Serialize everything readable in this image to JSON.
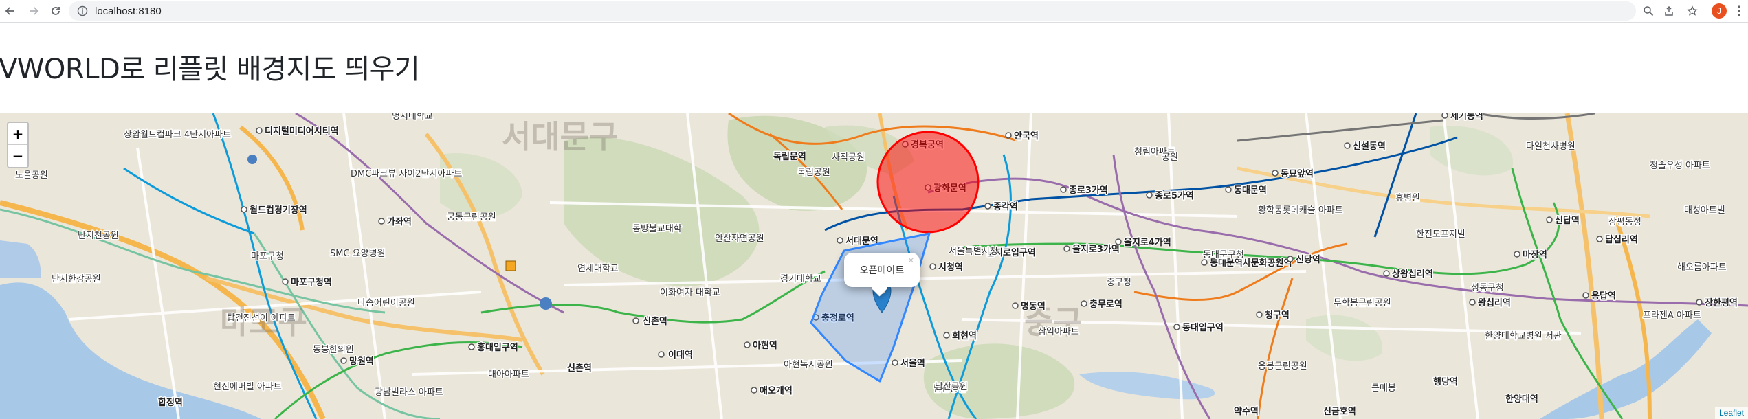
{
  "browser": {
    "url": "localhost:8180",
    "profile_initial": "J",
    "icons": [
      "back-arrow-icon",
      "forward-arrow-icon",
      "reload-icon",
      "site-info-icon",
      "zoom-icon",
      "share-icon",
      "bookmark-star-icon",
      "profile-avatar",
      "more-menu-icon"
    ]
  },
  "page": {
    "title": "VWORLD로 리플릿 배경지도 띄우기"
  },
  "map": {
    "zoom_in_label": "+",
    "zoom_out_label": "−",
    "popup_text": "오픈메이트",
    "popup_close": "×",
    "attribution": "Leaflet",
    "circle_color": "#ff0000",
    "polygon_color": "#3388ff",
    "marker_color": "#2a81cb",
    "districts": [
      "서대문구",
      "마포구",
      "중구"
    ],
    "stations": [
      "신촌역",
      "이대역",
      "아현역",
      "충정로역",
      "서울역",
      "시청역",
      "광화문역",
      "경복궁역",
      "안국역",
      "종각역",
      "종로3가역",
      "종로5가역",
      "동대문역",
      "동묘앞역",
      "을지로입구역",
      "을지로3가역",
      "을지로4가역",
      "동대문역사문화공원역",
      "신당역",
      "충무로역",
      "회현역",
      "명동역",
      "동대입구역",
      "약수역",
      "청구역",
      "신금호역",
      "행당역",
      "상왕십리역",
      "왕십리역",
      "한양대역",
      "마장역",
      "답십리역",
      "용답역",
      "장한평역",
      "신설동역",
      "제기동역",
      "독립문역",
      "홍대입구역",
      "합정역",
      "망원역",
      "마포구청역",
      "월드컵경기장역",
      "디지털미디어시티역",
      "가좌역",
      "신촌역",
      "애오개역",
      "서대문역",
      "신답역"
    ],
    "places": [
      "명지대학교",
      "상암월드컵파크 4단지아파트",
      "노을공원",
      "DMC파크뷰 자이2단지아파트",
      "궁동근린공원",
      "난지천공원",
      "SMC 요양병원",
      "마포구청",
      "난지한강공원",
      "탑건진선이 아파트",
      "동붕한의원",
      "다솜어린이공원",
      "현진에버빌 아파트",
      "광남빌라스 아파트",
      "대아아파트",
      "동방불교대학",
      "연세대학교",
      "이화여자 대학교",
      "안산자연공원",
      "경기대학교",
      "사직공원",
      "독립공원",
      "아현녹지공원",
      "남산공원",
      "삼익아파트",
      "청림아파트",
      "공원",
      "황학동롯데캐슬 아파트",
      "한진도프지빌",
      "무학봉근린공원",
      "응봉근린공원",
      "서울특별시청",
      "중구청",
      "동대문구청",
      "다일천사병원",
      "청솔우성 아파트",
      "대성아트빌",
      "장평동성",
      "해오름아파트",
      "프라젠A 아파트",
      "한양대학교병원 서관",
      "성동구청",
      "휴병원",
      "큰매봉",
      "남산공원"
    ]
  }
}
